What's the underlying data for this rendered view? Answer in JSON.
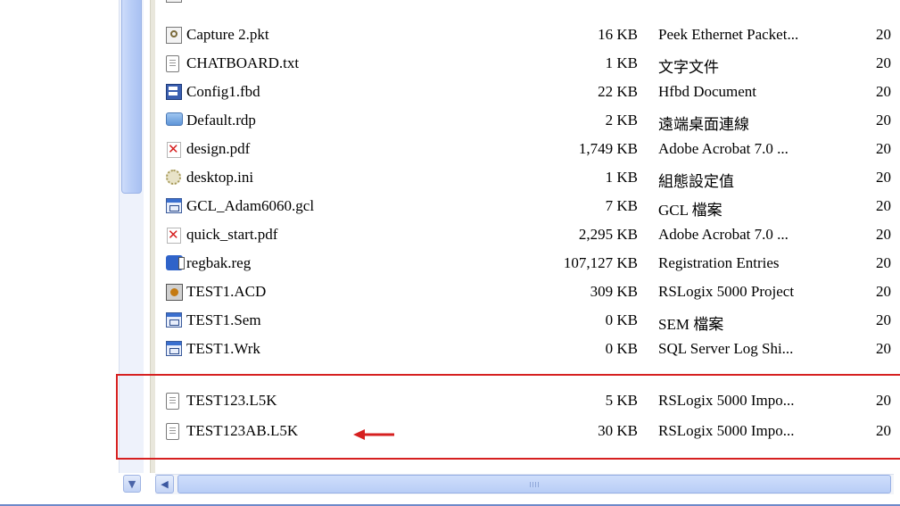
{
  "files": [
    {
      "icon": "capture-file-icon",
      "name": "Capture 2.pkt",
      "size": "16 KB",
      "type": "Peek Ethernet Packet...",
      "date": "20"
    },
    {
      "icon": "text-file-icon",
      "name": "CHATBOARD.txt",
      "size": "1 KB",
      "type": "文字文件",
      "date": "20"
    },
    {
      "icon": "fbd-document-icon",
      "name": "Config1.fbd",
      "size": "22 KB",
      "type": "Hfbd Document",
      "date": "20"
    },
    {
      "icon": "remote-desktop-icon",
      "name": "Default.rdp",
      "size": "2 KB",
      "type": "遠端桌面連線",
      "date": "20"
    },
    {
      "icon": "pdf-file-icon",
      "name": "design.pdf",
      "size": "1,749 KB",
      "type": "Adobe Acrobat 7.0 ...",
      "date": "20"
    },
    {
      "icon": "settings-file-icon",
      "name": "desktop.ini",
      "size": "1 KB",
      "type": "組態設定值",
      "date": "20"
    },
    {
      "icon": "gcl-file-icon",
      "name": "GCL_Adam6060.gcl",
      "size": "7 KB",
      "type": "GCL 檔案",
      "date": "20"
    },
    {
      "icon": "pdf-file-icon",
      "name": "quick_start.pdf",
      "size": "2,295 KB",
      "type": "Adobe Acrobat 7.0 ...",
      "date": "20"
    },
    {
      "icon": "registry-file-icon",
      "name": "regbak.reg",
      "size": "107,127 KB",
      "type": "Registration Entries",
      "date": "20"
    },
    {
      "icon": "rslogix-project-icon",
      "name": "TEST1.ACD",
      "size": "309 KB",
      "type": "RSLogix 5000 Project",
      "date": "20"
    },
    {
      "icon": "sem-file-icon",
      "name": "TEST1.Sem",
      "size": "0 KB",
      "type": "SEM 檔案",
      "date": "20"
    },
    {
      "icon": "sql-log-file-icon",
      "name": "TEST1.Wrk",
      "size": "0 KB",
      "type": "SQL Server Log Shi...",
      "date": "20"
    },
    {
      "icon": "text-file-icon",
      "name": "TEST123.L5K",
      "size": "5 KB",
      "type": "RSLogix 5000 Impo...",
      "date": "20"
    },
    {
      "icon": "text-file-icon",
      "name": "TEST123AB.L5K",
      "size": "30 KB",
      "type": "RSLogix 5000 Impo...",
      "date": "20"
    }
  ],
  "annotation": {
    "color": "#d62020"
  }
}
